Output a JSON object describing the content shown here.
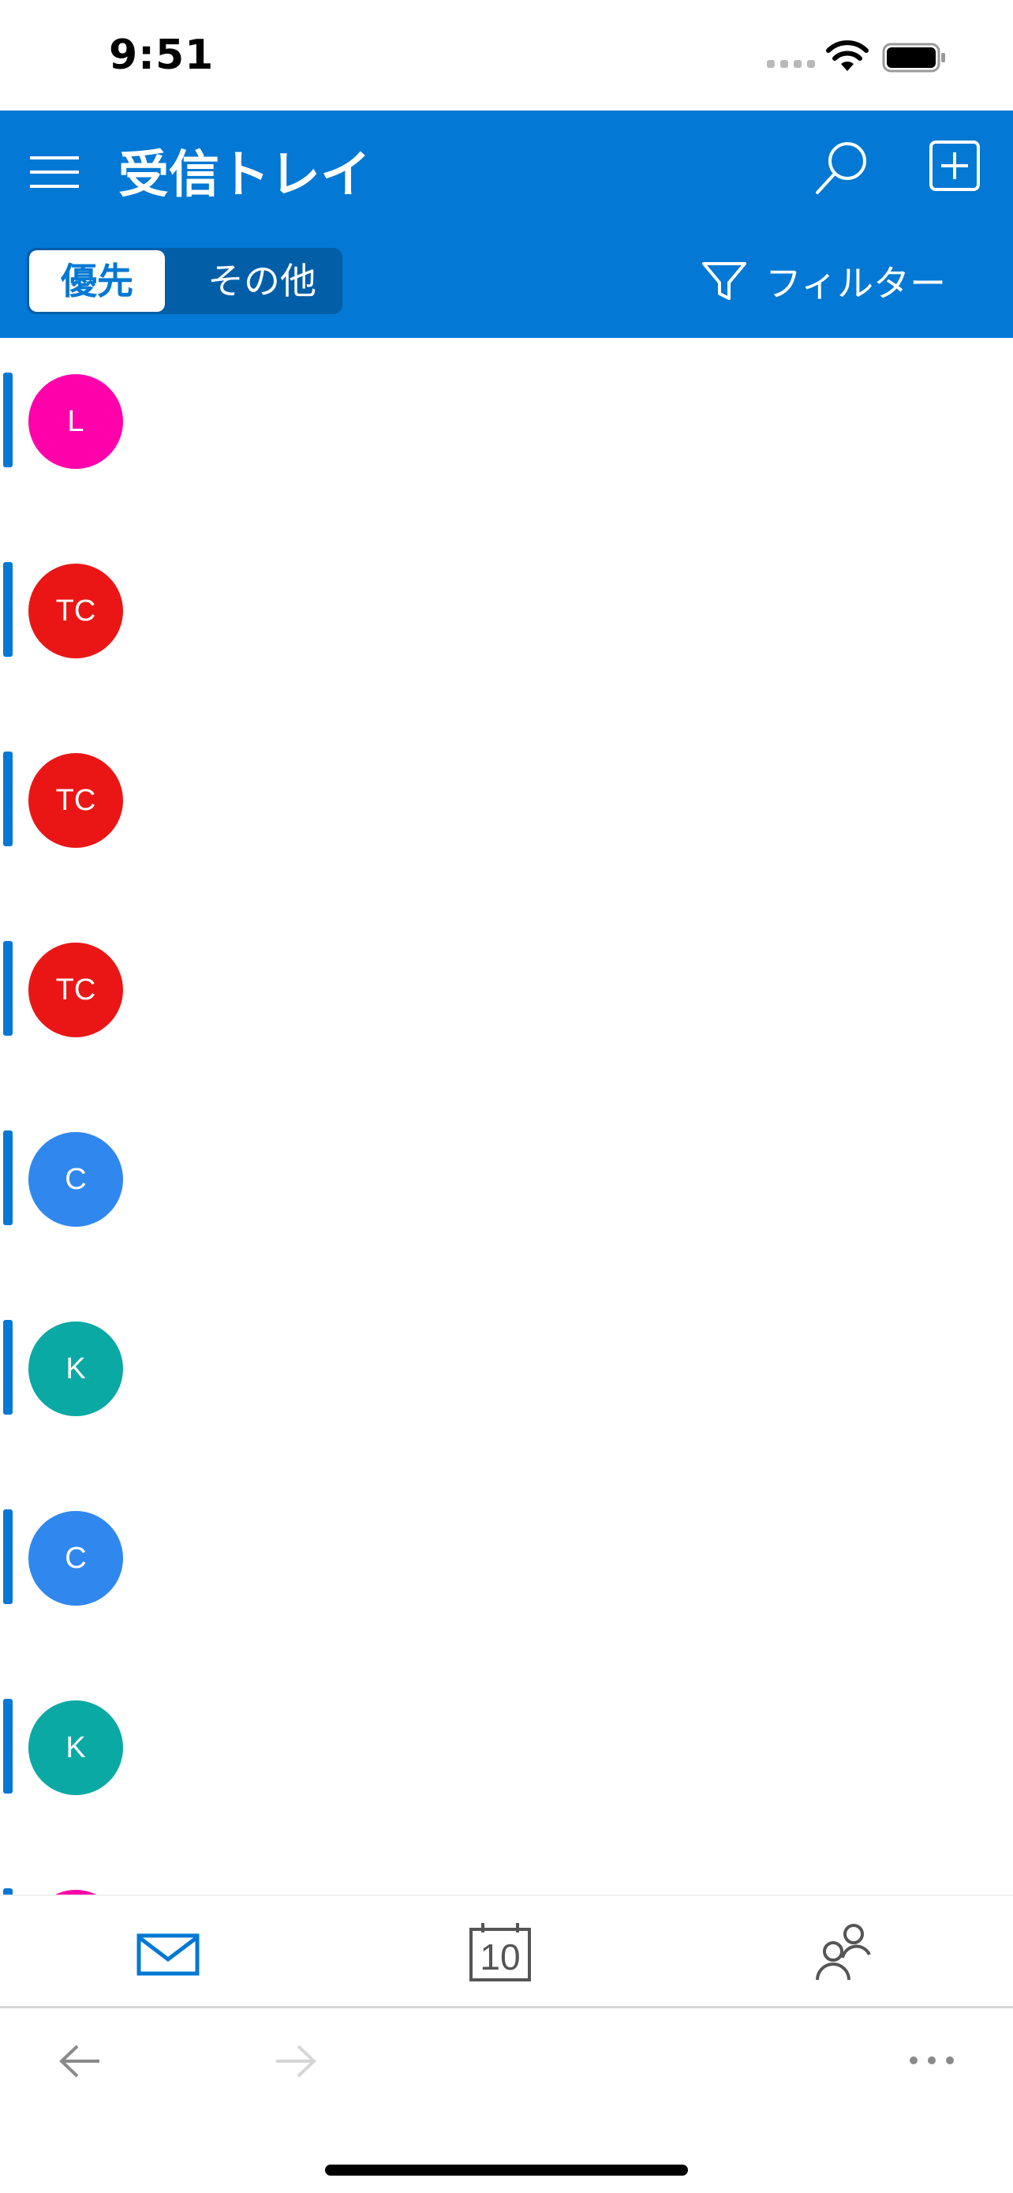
{
  "status_bar": {
    "time": "9:51"
  },
  "header": {
    "title": "受信トレイ",
    "tabs": [
      {
        "label": "優先",
        "selected": true
      },
      {
        "label": "その他",
        "selected": false
      }
    ],
    "filter_label": "フィルター"
  },
  "colors": {
    "accent": "#0378d4",
    "header_bg": "#0378d4",
    "segment_bg": "#035ea8",
    "unread_bar": "#0378d4"
  },
  "messages": [
    {
      "initials": "L",
      "avatar_color": "#ff00aa",
      "unread": true
    },
    {
      "initials": "TC",
      "avatar_color": "#ea1616",
      "unread": true
    },
    {
      "initials": "TC",
      "avatar_color": "#ea1616",
      "unread": true
    },
    {
      "initials": "TC",
      "avatar_color": "#ea1616",
      "unread": true
    },
    {
      "initials": "C",
      "avatar_color": "#3088ee",
      "unread": true
    },
    {
      "initials": "K",
      "avatar_color": "#0aa9a3",
      "unread": true
    },
    {
      "initials": "C",
      "avatar_color": "#3088ee",
      "unread": true
    },
    {
      "initials": "K",
      "avatar_color": "#0aa9a3",
      "unread": true
    },
    {
      "initials": "",
      "avatar_color": "#ff00aa",
      "unread": true
    }
  ],
  "tab_bar": {
    "items": [
      {
        "name": "mail-icon",
        "active": true
      },
      {
        "name": "calendar-icon",
        "day": "10",
        "active": false
      },
      {
        "name": "people-icon",
        "active": false
      }
    ]
  },
  "nav_bar": {
    "items": [
      "back-arrow-icon",
      "forward-arrow-icon",
      "more-icon"
    ]
  }
}
